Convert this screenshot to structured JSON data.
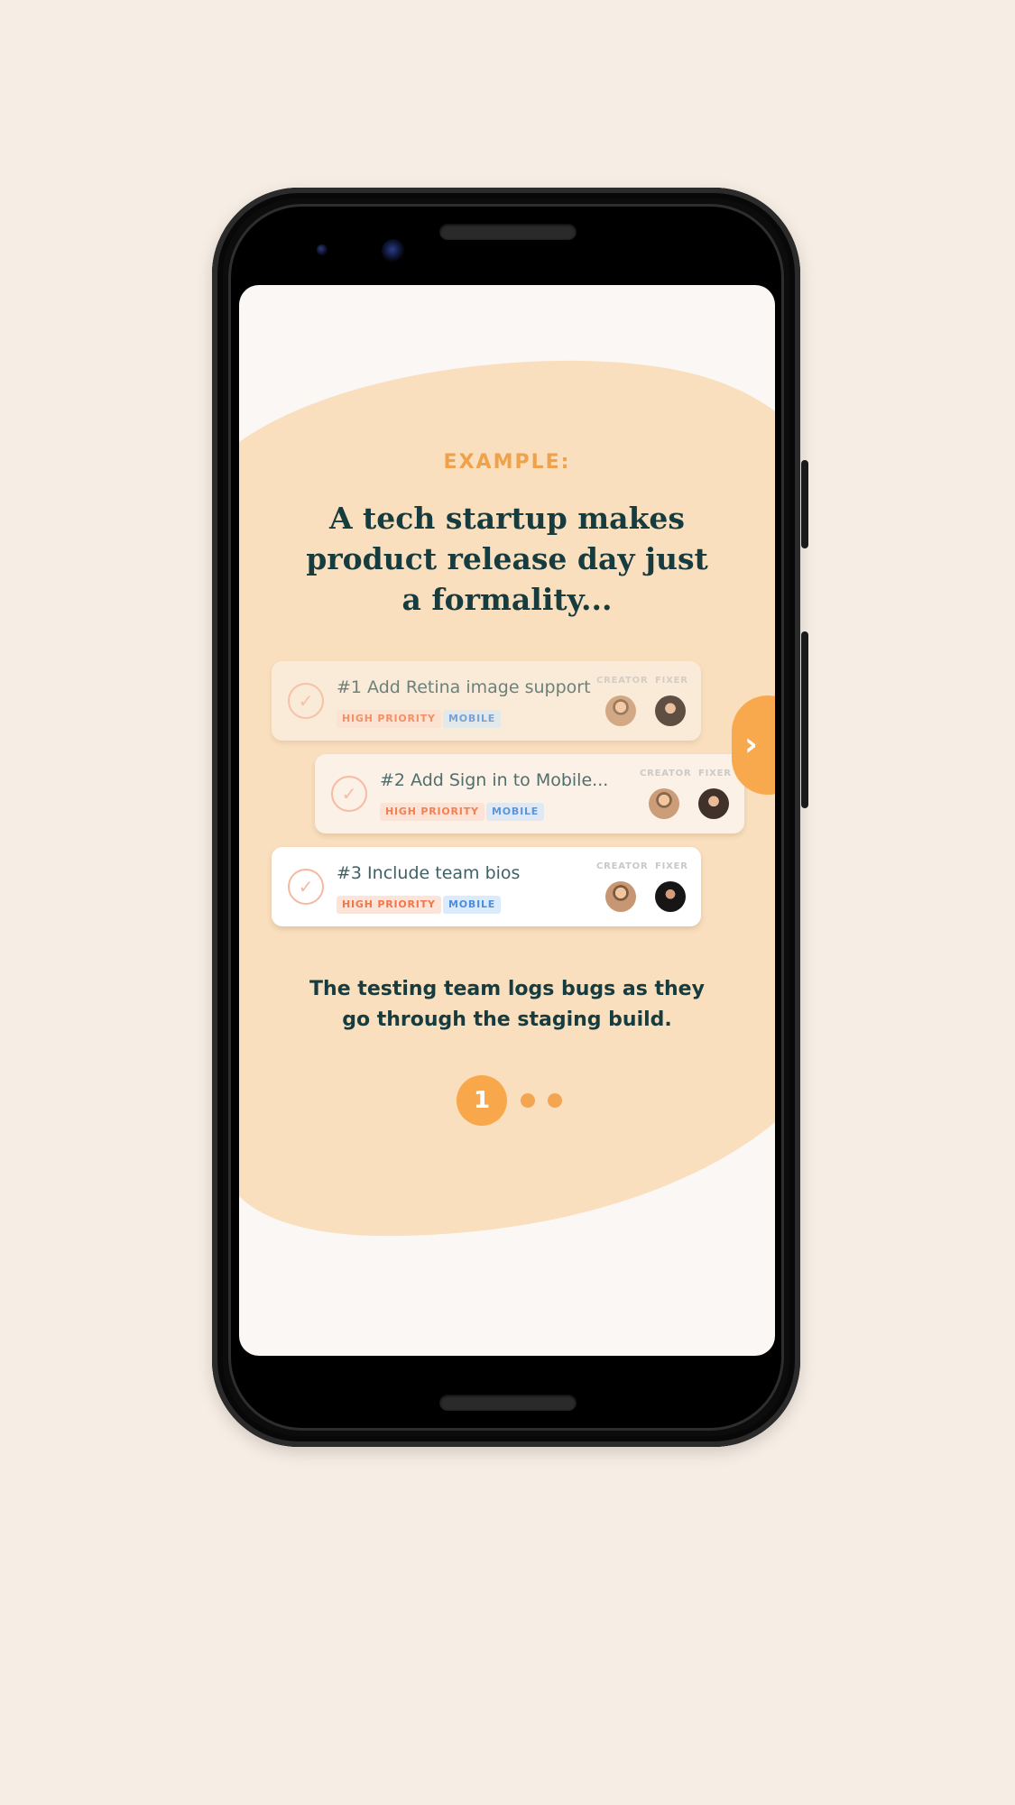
{
  "onboarding": {
    "eyebrow": "EXAMPLE:",
    "headline": "A tech startup makes product release day just a formality...",
    "caption": "The testing team logs bugs as they go through the staging build.",
    "tickets": [
      {
        "title": "#1 Add Retina image support",
        "priority": "HIGH PRIORITY",
        "tag": "MOBILE",
        "creator_label": "CREATOR",
        "fixer_label": "FIXER"
      },
      {
        "title": "#2 Add Sign in to Mobile...",
        "priority": "HIGH PRIORITY",
        "tag": "MOBILE",
        "creator_label": "CREATOR",
        "fixer_label": "FIXER"
      },
      {
        "title": "#3 Include team bios",
        "priority": "HIGH PRIORITY",
        "tag": "MOBILE",
        "creator_label": "CREATOR",
        "fixer_label": "FIXER"
      }
    ],
    "pager": {
      "current": "1",
      "total_pages": 3
    },
    "next_icon": "chevron-right-icon"
  },
  "colors": {
    "accent": "#f8a84a",
    "blob": "#f9dfbe",
    "text": "#173c3f",
    "priority": "#f0774a",
    "mobile": "#4d8edb"
  }
}
